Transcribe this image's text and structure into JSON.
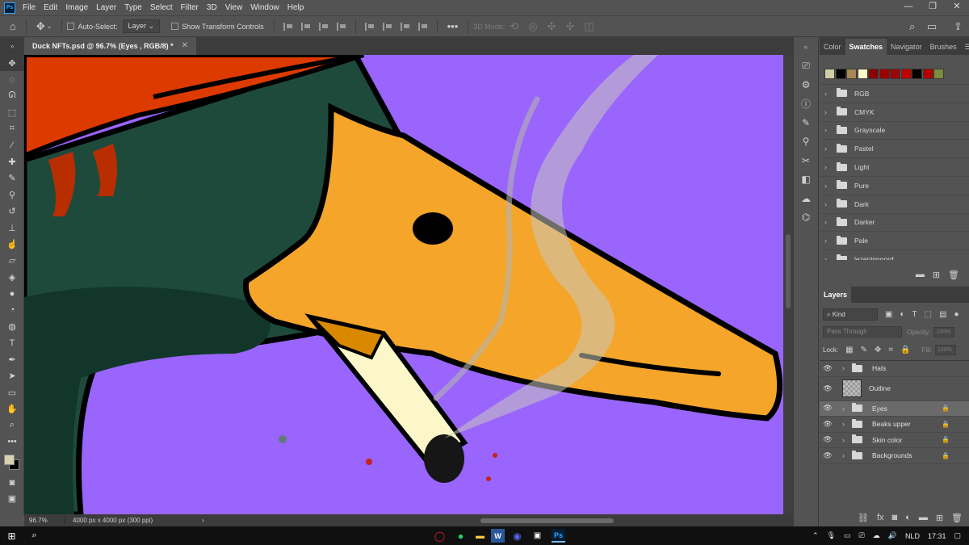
{
  "app": {
    "logo": "Ps"
  },
  "menu": [
    "File",
    "Edit",
    "Image",
    "Layer",
    "Type",
    "Select",
    "Filter",
    "3D",
    "View",
    "Window",
    "Help"
  ],
  "window_controls": {
    "minimize": "—",
    "restore": "❐",
    "close": "✕"
  },
  "options_bar": {
    "auto_select_label": "Auto-Select:",
    "auto_select_value": "Layer",
    "show_transform_label": "Show Transform Controls",
    "more": "•••",
    "mode_3d_label": "3D Mode:"
  },
  "document": {
    "tab_title": "Duck NFTs.psd @ 96.7% (Eyes , RGB/8) *",
    "close": "✕"
  },
  "status": {
    "zoom": "96.7%",
    "doc_info": "4000 px x 4000 px (300 ppi)"
  },
  "swatch_panel": {
    "tabs": [
      "Color",
      "Swatches",
      "Navigator",
      "Brushes"
    ],
    "active_tab": "Swatches",
    "swatches": [
      "#cfcfa6",
      "#000000",
      "#a88756",
      "#fcfbc8",
      "#8a0000",
      "#9e0000",
      "#9d0609",
      "#c10000",
      "#000000",
      "#b30000",
      "#7d8b3c"
    ],
    "groups": [
      "RGB",
      "CMYK",
      "Grayscale",
      "Pastel",
      "Light",
      "Pure",
      "Dark",
      "Darker",
      "Pale",
      "lezeninnoord"
    ]
  },
  "layers_panel": {
    "title": "Layers",
    "kind_label": "Kind",
    "blend_mode": "Pass Through",
    "opacity_label": "Opacity:",
    "opacity_value": "100%",
    "lock_label": "Lock:",
    "fill_label": "Fill:",
    "fill_value": "100%",
    "layers": [
      {
        "name": "Hats",
        "type": "group",
        "locked": false,
        "selected": false
      },
      {
        "name": "Outline",
        "type": "pixel",
        "locked": false,
        "selected": false
      },
      {
        "name": "Eyes",
        "type": "group",
        "locked": true,
        "selected": true
      },
      {
        "name": "Beaks upper",
        "type": "group",
        "locked": true,
        "selected": false
      },
      {
        "name": "Skin color",
        "type": "group",
        "locked": true,
        "selected": false
      },
      {
        "name": "Backgrounds",
        "type": "group",
        "locked": true,
        "selected": false
      }
    ]
  },
  "colors": {
    "foreground": "#d7d2b0",
    "background": "#000000",
    "canvas_bg": "#9965fc",
    "beak": "#f4a52a",
    "duck_green": "#1e4a3c",
    "hat": "#dd3a00"
  },
  "taskbar": {
    "language": "NLD",
    "time": "17:31",
    "ps_label": "Ps",
    "word_label": "W"
  }
}
